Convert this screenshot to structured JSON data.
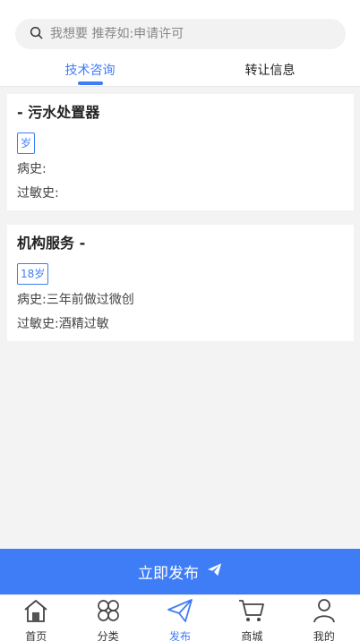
{
  "search": {
    "placeholder": "我想要 推荐如:申请许可"
  },
  "tabs": [
    {
      "label": "技术咨询",
      "active": true
    },
    {
      "label": "转让信息",
      "active": false
    }
  ],
  "cards": [
    {
      "title": "- 污水处置器",
      "age": "岁",
      "history": "病史:",
      "allergy": "过敏史:"
    },
    {
      "title": "机构服务 -",
      "age": "18岁",
      "history": "病史:三年前做过微创",
      "allergy": "过敏史:酒精过敏"
    }
  ],
  "publish": {
    "label": "立即发布"
  },
  "tabbar": [
    {
      "label": "首页",
      "icon": "home-icon"
    },
    {
      "label": "分类",
      "icon": "category-icon"
    },
    {
      "label": "发布",
      "icon": "send-icon",
      "active": true
    },
    {
      "label": "商城",
      "icon": "cart-icon"
    },
    {
      "label": "我的",
      "icon": "user-icon"
    }
  ],
  "colors": {
    "accent": "#3f7df7",
    "background": "#f3f3f3"
  }
}
